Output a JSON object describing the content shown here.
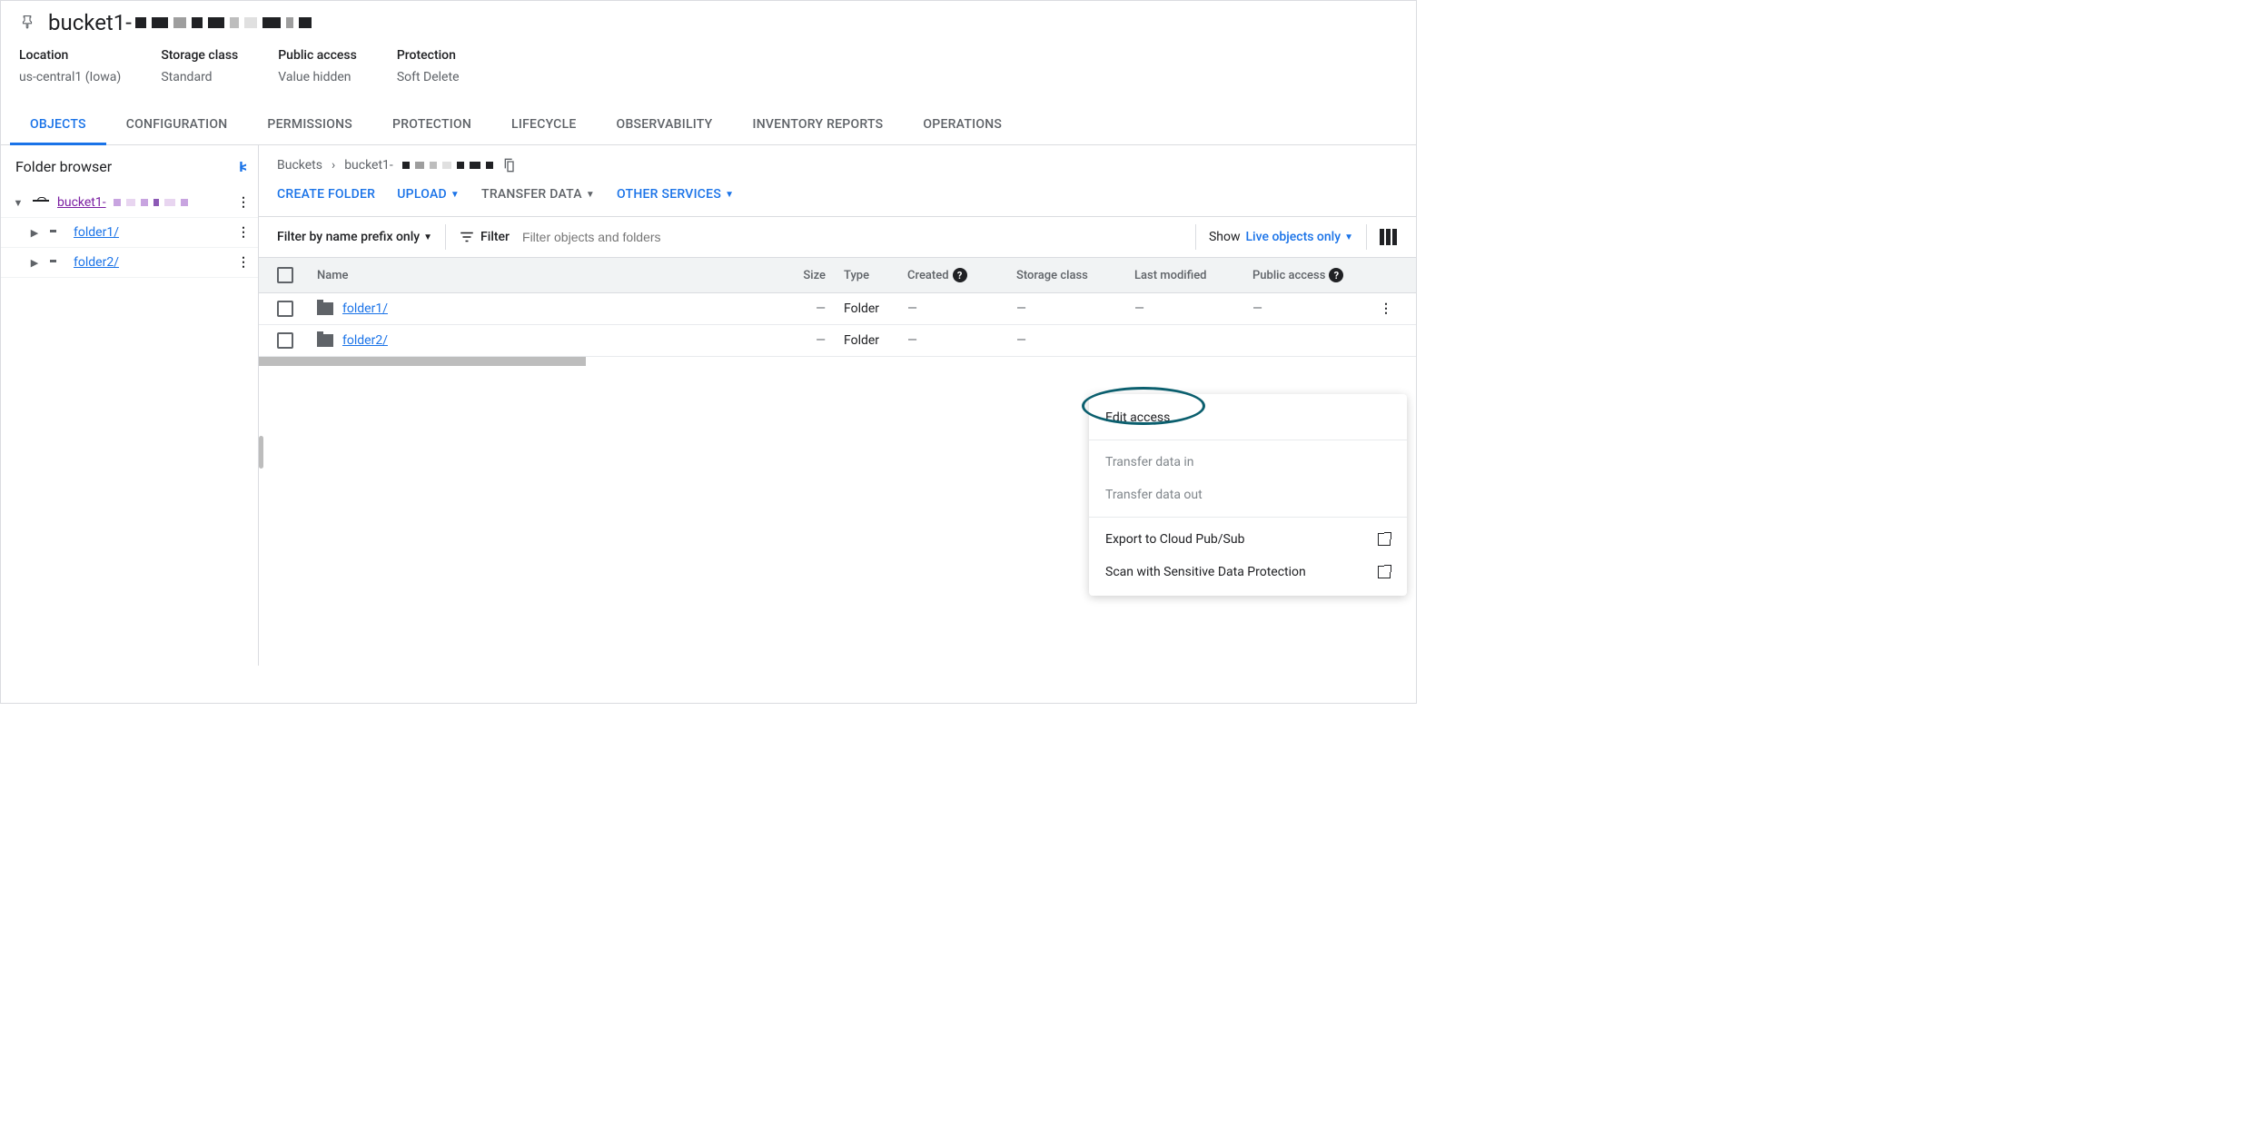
{
  "header": {
    "title_prefix": "bucket1-"
  },
  "meta": [
    {
      "label": "Location",
      "value": "us-central1 (Iowa)"
    },
    {
      "label": "Storage class",
      "value": "Standard"
    },
    {
      "label": "Public access",
      "value": "Value hidden"
    },
    {
      "label": "Protection",
      "value": "Soft Delete"
    }
  ],
  "tabs": [
    "OBJECTS",
    "CONFIGURATION",
    "PERMISSIONS",
    "PROTECTION",
    "LIFECYCLE",
    "OBSERVABILITY",
    "INVENTORY REPORTS",
    "OPERATIONS"
  ],
  "sidebar": {
    "title": "Folder browser",
    "root": "bucket1-",
    "folders": [
      "folder1/",
      "folder2/"
    ]
  },
  "crumbs": {
    "root": "Buckets",
    "current": "bucket1-"
  },
  "actions": {
    "create_folder": "CREATE FOLDER",
    "upload": "UPLOAD",
    "transfer": "TRANSFER DATA",
    "other": "OTHER SERVICES"
  },
  "filter": {
    "type": "Filter by name prefix only",
    "label": "Filter",
    "placeholder": "Filter objects and folders",
    "show_label": "Show",
    "show_value": "Live objects only"
  },
  "columns": {
    "name": "Name",
    "size": "Size",
    "type": "Type",
    "created": "Created",
    "sclass": "Storage class",
    "lmod": "Last modified",
    "pacc": "Public access"
  },
  "rows": [
    {
      "name": "folder1/",
      "size": "—",
      "type": "Folder",
      "created": "—",
      "sclass": "—",
      "lmod": "—",
      "pacc": "—"
    },
    {
      "name": "folder2/",
      "size": "—",
      "type": "Folder",
      "created": "—",
      "sclass": "—",
      "lmod": "",
      "pacc": ""
    }
  ],
  "context_menu": {
    "edit_access": "Edit access",
    "transfer_in": "Transfer data in",
    "transfer_out": "Transfer data out",
    "export_pubsub": "Export to Cloud Pub/Sub",
    "scan_sdp": "Scan with Sensitive Data Protection"
  }
}
